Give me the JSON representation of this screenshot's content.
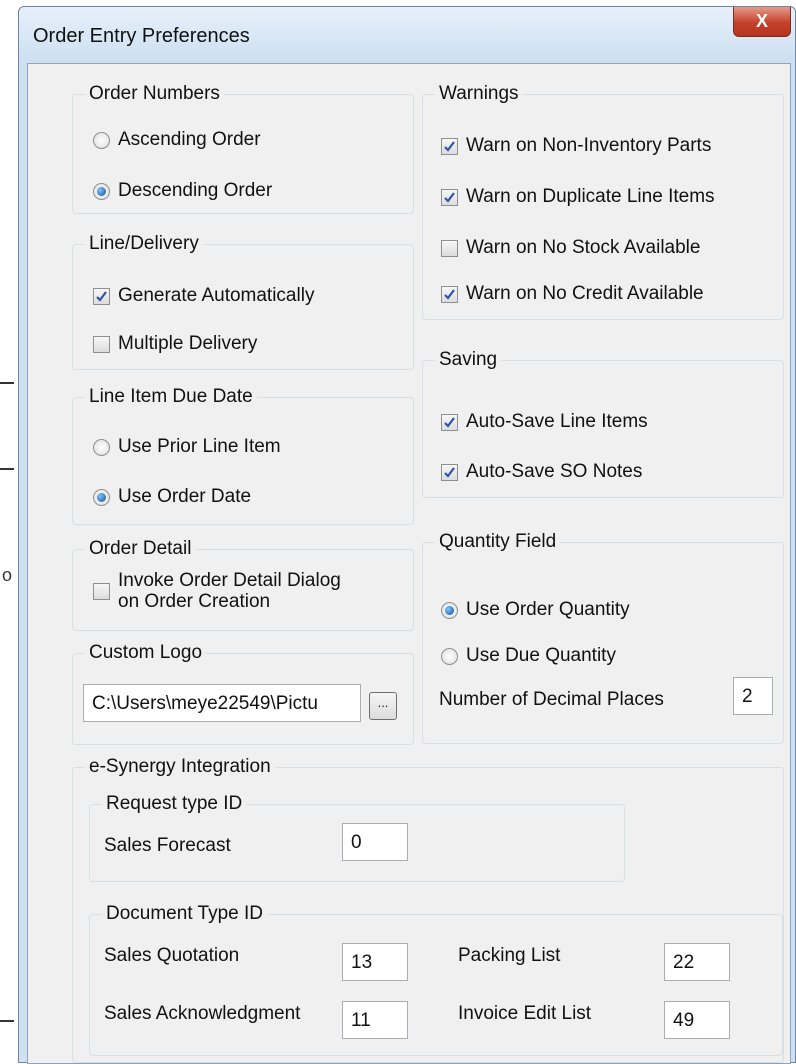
{
  "window": {
    "title": "Order Entry Preferences",
    "close_label": "X"
  },
  "background": {
    "fragment_letter": "o"
  },
  "order_numbers": {
    "title": "Order Numbers",
    "options": [
      {
        "label": "Ascending Order",
        "selected": false
      },
      {
        "label": "Descending Order",
        "selected": true
      }
    ]
  },
  "line_delivery": {
    "title": "Line/Delivery",
    "options": [
      {
        "label": "Generate Automatically",
        "checked": true
      },
      {
        "label": "Multiple Delivery",
        "checked": false
      }
    ]
  },
  "line_item_due_date": {
    "title": "Line Item Due Date",
    "options": [
      {
        "label": "Use Prior Line Item",
        "selected": false
      },
      {
        "label": "Use Order Date",
        "selected": true
      }
    ]
  },
  "order_detail": {
    "title": "Order Detail",
    "option": {
      "label_line1": "Invoke Order Detail Dialog",
      "label_line2": "on Order Creation",
      "checked": false
    }
  },
  "custom_logo": {
    "title": "Custom Logo",
    "path_value": "C:\\Users\\meye22549\\Pictu",
    "browse_label": "..."
  },
  "warnings": {
    "title": "Warnings",
    "options": [
      {
        "label": "Warn on Non-Inventory Parts",
        "checked": true
      },
      {
        "label": "Warn on Duplicate Line Items",
        "checked": true
      },
      {
        "label": "Warn on No Stock Available",
        "checked": false
      },
      {
        "label": "Warn on No Credit Available",
        "checked": true
      }
    ]
  },
  "saving": {
    "title": "Saving",
    "options": [
      {
        "label": "Auto-Save Line Items",
        "checked": true
      },
      {
        "label": "Auto-Save SO Notes",
        "checked": true
      }
    ]
  },
  "quantity_field": {
    "title": "Quantity Field",
    "options": [
      {
        "label": "Use Order Quantity",
        "selected": true
      },
      {
        "label": "Use Due Quantity",
        "selected": false
      }
    ],
    "decimal_label": "Number of Decimal Places",
    "decimal_value": "2"
  },
  "esynergy": {
    "title": "e-Synergy Integration",
    "request_type": {
      "title": "Request type ID",
      "sales_forecast_label": "Sales Forecast",
      "sales_forecast_value": "0"
    },
    "document_type": {
      "title": "Document Type ID",
      "sales_quotation_label": "Sales Quotation",
      "sales_quotation_value": "13",
      "sales_ack_label": "Sales Acknowledgment",
      "sales_ack_value": "11",
      "packing_list_label": "Packing List",
      "packing_list_value": "22",
      "invoice_edit_label": "Invoice Edit List",
      "invoice_edit_value": "49"
    }
  }
}
